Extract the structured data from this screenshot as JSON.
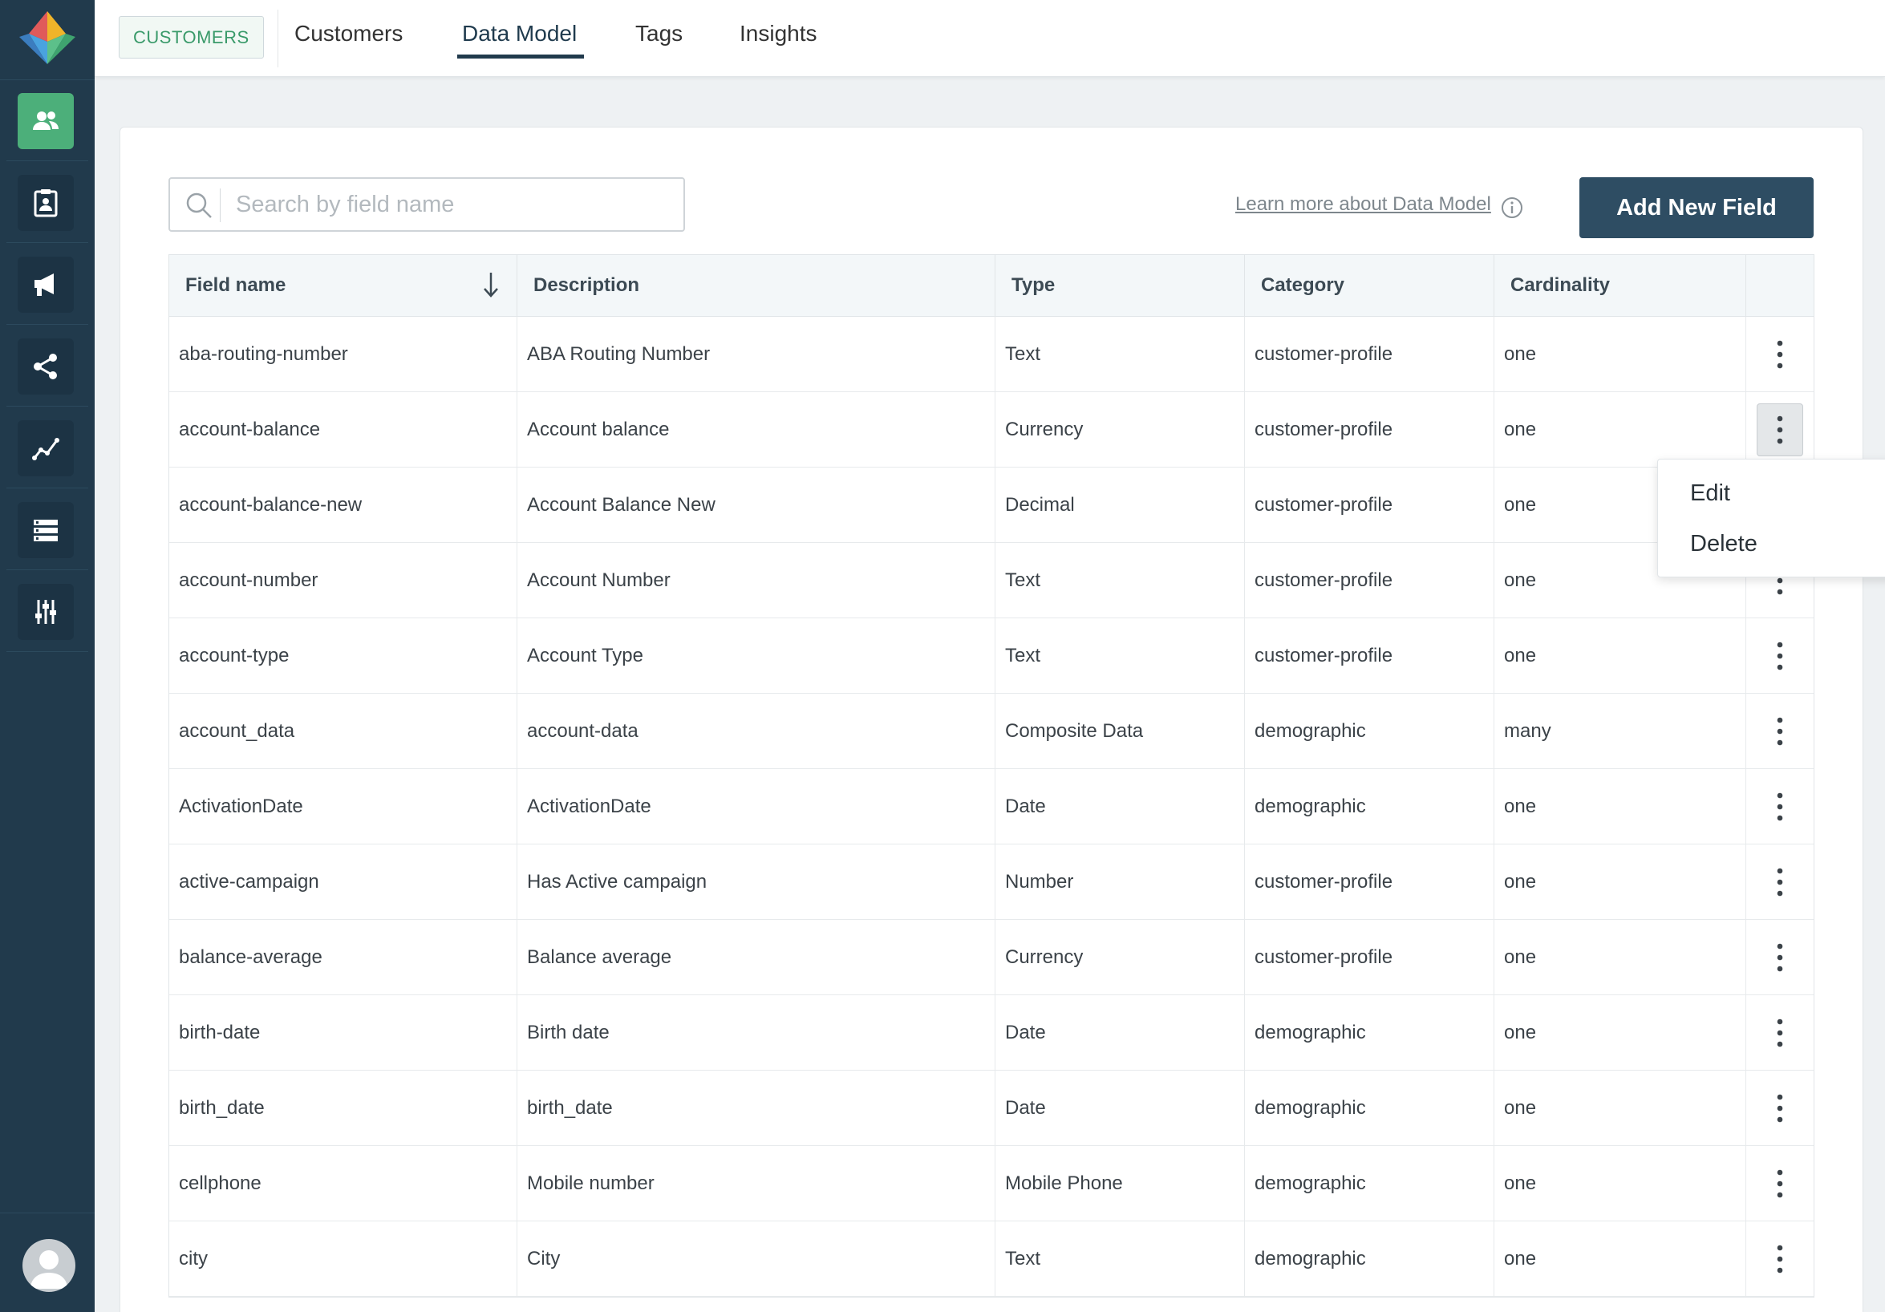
{
  "nav": {
    "module_label": "CUSTOMERS",
    "tabs": [
      {
        "label": "Customers"
      },
      {
        "label": "Data Model"
      },
      {
        "label": "Tags"
      },
      {
        "label": "Insights"
      }
    ]
  },
  "sidebar": {
    "items": [
      {
        "icon": "users-icon",
        "active": true
      },
      {
        "icon": "clipboard-badge-icon"
      },
      {
        "icon": "megaphone-icon"
      },
      {
        "icon": "share-nodes-icon"
      },
      {
        "icon": "line-chart-icon"
      },
      {
        "icon": "server-list-icon"
      },
      {
        "icon": "sliders-icon"
      }
    ]
  },
  "toolbar": {
    "search_placeholder": "Search by field name",
    "search_value": "",
    "learn_more": "Learn more about Data Model",
    "add_button": "Add New Field"
  },
  "table": {
    "headers": [
      "Field name",
      "Description",
      "Type",
      "Category",
      "Cardinality"
    ],
    "rows": [
      [
        "aba-routing-number",
        "ABA Routing Number",
        "Text",
        "customer-profile",
        "one"
      ],
      [
        "account-balance",
        "Account balance",
        "Currency",
        "customer-profile",
        "one"
      ],
      [
        "account-balance-new",
        "Account Balance New",
        "Decimal",
        "customer-profile",
        "one"
      ],
      [
        "account-number",
        "Account Number",
        "Text",
        "customer-profile",
        "one"
      ],
      [
        "account-type",
        "Account Type",
        "Text",
        "customer-profile",
        "one"
      ],
      [
        "account_data",
        "account-data",
        "Composite Data",
        "demographic",
        "many"
      ],
      [
        "ActivationDate",
        "ActivationDate",
        "Date",
        "demographic",
        "one"
      ],
      [
        "active-campaign",
        "Has Active campaign",
        "Number",
        "customer-profile",
        "one"
      ],
      [
        "balance-average",
        "Balance average",
        "Currency",
        "customer-profile",
        "one"
      ],
      [
        "birth-date",
        "Birth date",
        "Date",
        "demographic",
        "one"
      ],
      [
        "birth_date",
        "birth_date",
        "Date",
        "demographic",
        "one"
      ],
      [
        "cellphone",
        "Mobile number",
        "Mobile Phone",
        "demographic",
        "one"
      ],
      [
        "city",
        "City",
        "Text",
        "demographic",
        "one"
      ]
    ]
  },
  "row_menu": {
    "open_row": 1,
    "items": [
      "Edit",
      "Delete"
    ]
  },
  "colors": {
    "sidebar_bg": "#213a4c",
    "active_item": "#4caf7a",
    "primary_button": "#2e4d63"
  }
}
